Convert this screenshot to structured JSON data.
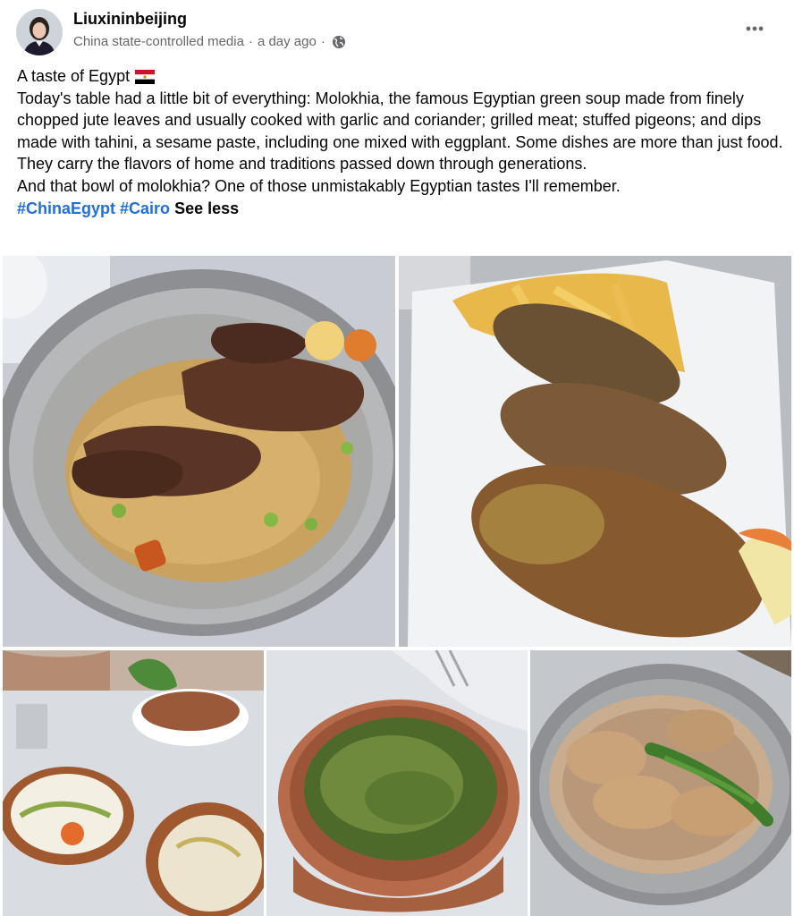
{
  "post": {
    "author": "Liuxininbeijing",
    "label": "China state-controlled media",
    "separator": "·",
    "time": "a day ago",
    "privacy_icon": "globe-icon",
    "more_icon": "more-dots-icon",
    "title_line": "A taste of Egypt",
    "title_emoji": "egypt-flag",
    "body_line1": "Today's table had a little bit of everything: Molokhia, the famous Egyptian green soup made from finely chopped jute leaves and usually cooked with garlic and coriander; grilled meat; stuffed pigeons; and dips made with tahini, a sesame paste, including one mixed with eggplant. Some dishes are more than just food. They carry the flavors of home and traditions passed down through generations.",
    "body_line2": "And that bowl of molokhia? One of those unmistakably Egyptian tastes I'll remember.",
    "hashtags": [
      "#ChinaEgypt",
      "#Cairo"
    ],
    "see_less": "See less"
  },
  "colors": {
    "hashtag": "#216fdb",
    "meta_text": "#65676b",
    "body_text": "#050505"
  },
  "photos": [
    {
      "subject": "grilled meat over rice on silver platter"
    },
    {
      "subject": "three stuffed pigeons with fries on white plate"
    },
    {
      "subject": "tahini and eggplant dips with salad"
    },
    {
      "subject": "bowl of green molokhia soup"
    },
    {
      "subject": "rice with meat and dill on silver platter"
    }
  ]
}
